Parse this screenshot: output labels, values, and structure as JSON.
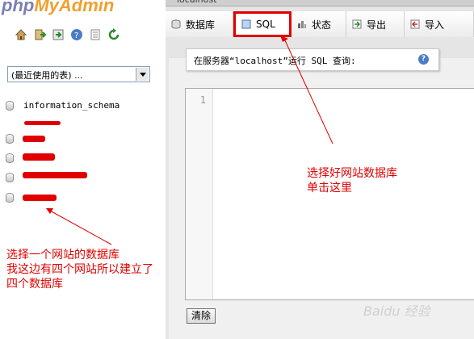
{
  "logo": {
    "php": "php",
    "rest": "MyAdmin"
  },
  "left_icons": [
    "home-icon",
    "exit-icon",
    "sql-query-icon",
    "help-icon",
    "docs-icon",
    "reload-icon"
  ],
  "table_select": {
    "value": "(最近使用的表) ..."
  },
  "databases": [
    {
      "name": "information_schema"
    },
    {
      "name": ""
    },
    {
      "name": ""
    },
    {
      "name": ""
    },
    {
      "name": ""
    }
  ],
  "window_title": "localhost",
  "tabs": [
    {
      "label": "数据库",
      "icon": "database-icon",
      "active": false
    },
    {
      "label": "SQL",
      "icon": "sql-icon",
      "active": true
    },
    {
      "label": "状态",
      "icon": "status-icon",
      "active": false
    },
    {
      "label": "导出",
      "icon": "export-icon",
      "active": false
    },
    {
      "label": "导入",
      "icon": "import-icon",
      "active": false
    }
  ],
  "query_header": "在服务器“localhost”运行 SQL 查询:",
  "editor": {
    "line_number": "1",
    "content": ""
  },
  "clear_button": "清除",
  "annotations": {
    "right_line1": "选择好网站数据库",
    "right_line2": "单击这里",
    "left_line1": "选择一个网站的数据库",
    "left_line2": "我这边有四个网站所以建立了四个数据库"
  },
  "watermark": "Baidu 经验",
  "colors": {
    "annotation_red": "#e00000",
    "accent": "#4a7dc4"
  }
}
